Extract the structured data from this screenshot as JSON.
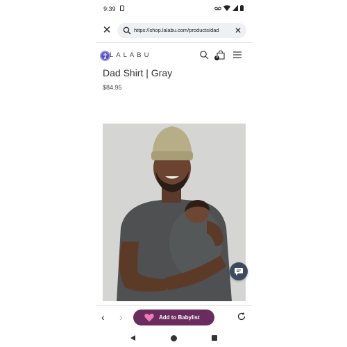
{
  "status_bar": {
    "time": "9:39",
    "icons": [
      "sim-icon",
      "voicemail-icon",
      "wifi-icon",
      "signal-icon",
      "battery-icon"
    ]
  },
  "browser": {
    "url": "https://shop.lalabu.com/products/dad",
    "close_tab_icon": "close-icon",
    "clear_url_icon": "close-icon"
  },
  "site_header": {
    "logo": "LALABU",
    "cart_count": "0",
    "icons": [
      "accessibility-icon",
      "search-icon",
      "cart-icon",
      "menu-icon"
    ]
  },
  "product": {
    "title": "Dad Shirt | Gray",
    "price": "$84.95"
  },
  "toolbar": {
    "babylist_label": "Add to Babylist",
    "icons": [
      "back-arrow-icon",
      "forward-arrow-icon",
      "heart-icon",
      "reload-icon"
    ]
  },
  "colors": {
    "babylist_button": "#6a2c5e",
    "accessibility_button": "#5b4fbf",
    "chat_button": "#3d4a5e",
    "url_bar": "#eef0f4"
  }
}
